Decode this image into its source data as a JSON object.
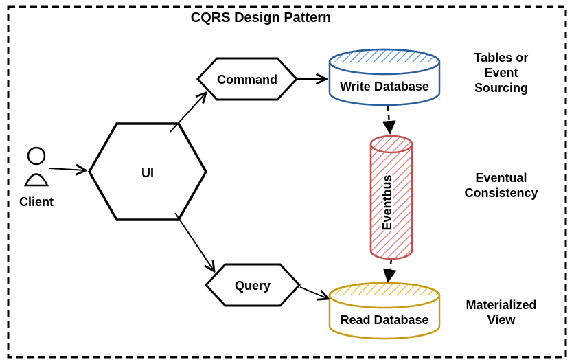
{
  "title": "CQRS Design Pattern",
  "client": {
    "label": "Client"
  },
  "ui": {
    "label": "UI"
  },
  "command": {
    "label": "Command"
  },
  "query": {
    "label": "Query"
  },
  "writeDb": {
    "label": "Write Database"
  },
  "eventbus": {
    "label": "Eventbus"
  },
  "readDb": {
    "label": "Read Database"
  },
  "notes": {
    "tablesEvent1": "Tables or",
    "tablesEvent2": "Event",
    "tablesEvent3": "Sourcing",
    "eventual1": "Eventual",
    "eventual2": "Consistency",
    "matView1": "Materialized",
    "matView2": "View"
  },
  "chart_data": {
    "type": "diagram",
    "title": "CQRS Design Pattern",
    "nodes": [
      {
        "id": "client",
        "label": "Client",
        "kind": "actor"
      },
      {
        "id": "ui",
        "label": "UI",
        "kind": "hexagon"
      },
      {
        "id": "command",
        "label": "Command",
        "kind": "hexagon"
      },
      {
        "id": "query",
        "label": "Query",
        "kind": "hexagon"
      },
      {
        "id": "writeDb",
        "label": "Write Database",
        "kind": "database",
        "note": "Tables or Event Sourcing"
      },
      {
        "id": "eventbus",
        "label": "Eventbus",
        "kind": "cylinder",
        "note": "Eventual Consistency"
      },
      {
        "id": "readDb",
        "label": "Read Database",
        "kind": "database",
        "note": "Materialized View"
      }
    ],
    "edges": [
      {
        "from": "client",
        "to": "ui",
        "style": "solid"
      },
      {
        "from": "ui",
        "to": "command",
        "style": "solid"
      },
      {
        "from": "ui",
        "to": "query",
        "style": "solid"
      },
      {
        "from": "command",
        "to": "writeDb",
        "style": "solid"
      },
      {
        "from": "query",
        "to": "readDb",
        "style": "solid"
      },
      {
        "from": "writeDb",
        "to": "eventbus",
        "style": "dashed"
      },
      {
        "from": "eventbus",
        "to": "readDb",
        "style": "dashed"
      }
    ]
  }
}
